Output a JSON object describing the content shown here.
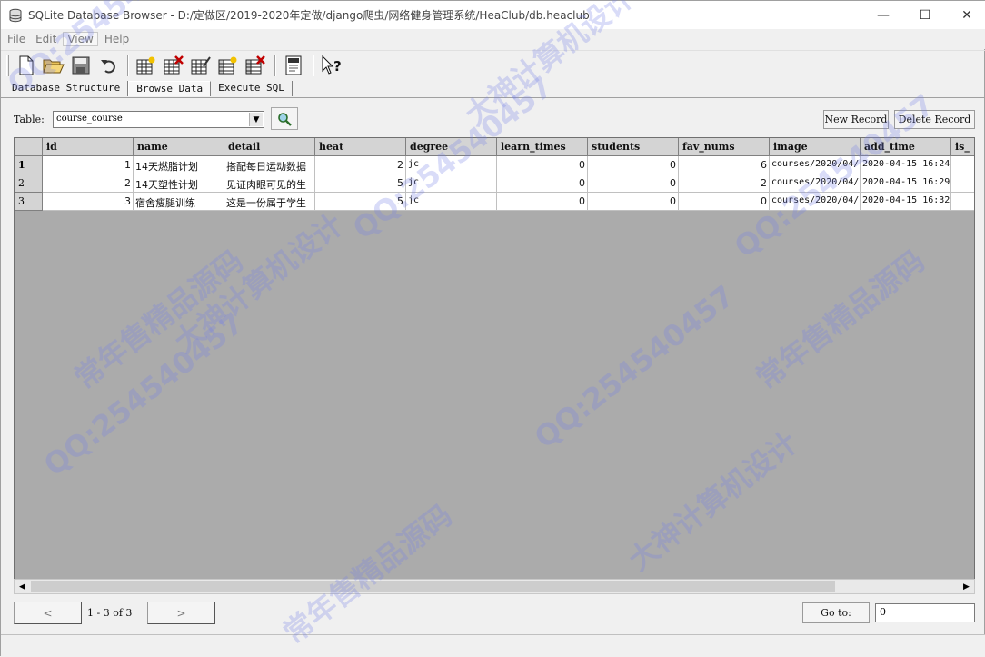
{
  "window": {
    "title": "SQLite Database Browser - D:/定做区/2019-2020年定做/django爬虫/网络健身管理系统/HeaClub/db.heaclub",
    "minimize": "—",
    "maximize": "☐",
    "close": "✕"
  },
  "menu": [
    "File",
    "Edit",
    "View",
    "Help"
  ],
  "toolbar": {
    "icons": [
      "new-database-icon",
      "open-database-icon",
      "save-database-icon",
      "undo-icon",
      "create-table-icon",
      "delete-table-icon",
      "modify-table-icon",
      "create-index-icon",
      "delete-index-icon",
      "sql-log-icon",
      "whats-this-icon"
    ]
  },
  "tabs": [
    {
      "label": "Database Structure",
      "selected": false
    },
    {
      "label": "Browse Data",
      "selected": true
    },
    {
      "label": "Execute SQL",
      "selected": false
    }
  ],
  "browse": {
    "table_label": "Table:",
    "table_value": "course_course",
    "new_record": "New Record",
    "delete_record": "Delete Record"
  },
  "grid": {
    "columns": [
      "id",
      "name",
      "detail",
      "heat",
      "degree",
      "learn_times",
      "students",
      "fav_nums",
      "image",
      "add_time",
      "is_"
    ],
    "rows": [
      {
        "num": "1",
        "cells": [
          "1",
          "14天燃脂计划",
          "搭配每日运动数据",
          "2",
          "jc",
          "0",
          "0",
          "6",
          "courses/2020/04/",
          "2020-04-15 16:24",
          ""
        ]
      },
      {
        "num": "2",
        "cells": [
          "2",
          "14天塑性计划",
          "见证肉眼可见的生",
          "5",
          "jc",
          "0",
          "0",
          "2",
          "courses/2020/04/",
          "2020-04-15 16:29",
          ""
        ]
      },
      {
        "num": "3",
        "cells": [
          "3",
          "宿舍瘦腿训练",
          "这是一份属于学生",
          "5",
          "jc",
          "0",
          "0",
          "0",
          "courses/2020/04/",
          "2020-04-15 16:32",
          ""
        ]
      }
    ]
  },
  "scroll": {
    "left": "◀",
    "right": "▶"
  },
  "navigation": {
    "prev": "<",
    "next": ">",
    "record_count": "1 - 3 of 3",
    "goto_label": "Go to:",
    "goto_value": "0"
  },
  "watermark": [
    "QQ:254540457",
    "大神计算机设计",
    "常年售精品源码"
  ]
}
